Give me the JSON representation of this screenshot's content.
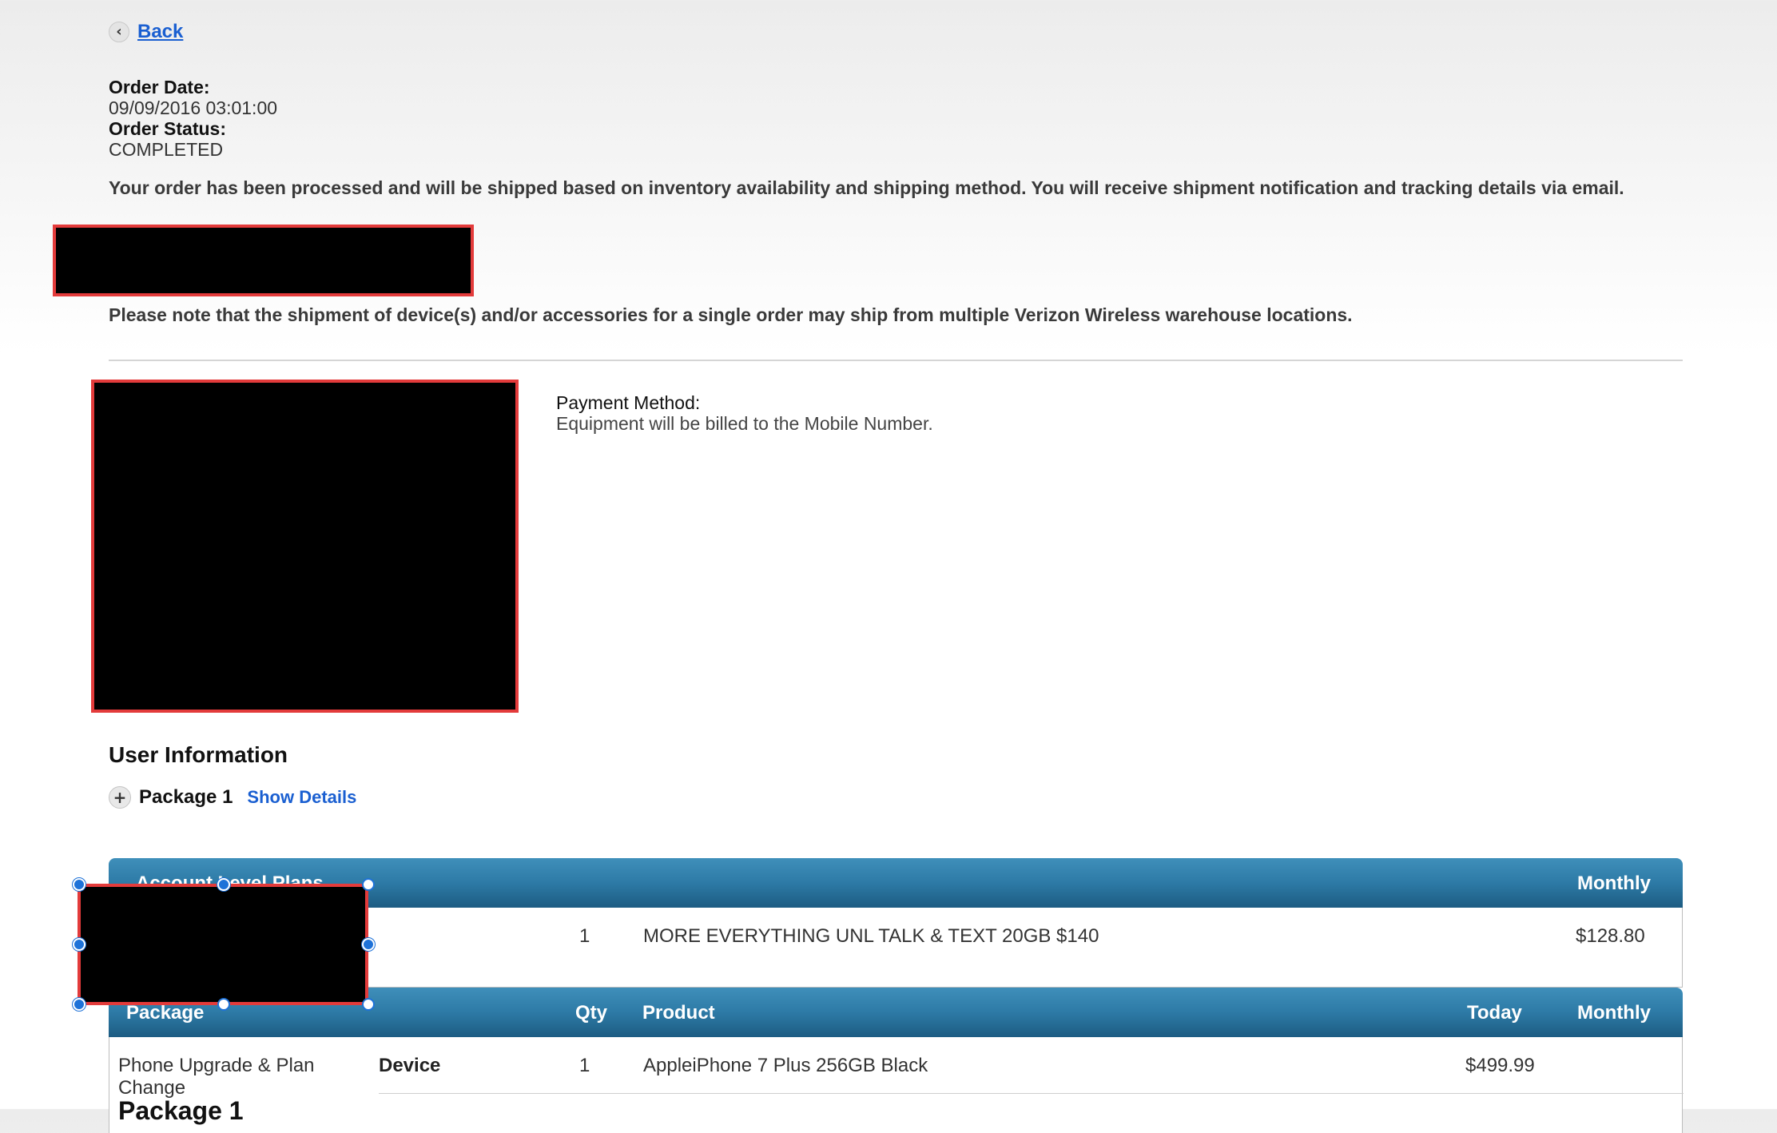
{
  "nav": {
    "back_label": "Back",
    "back_icon": "chevron-left-icon"
  },
  "order": {
    "date_label": "Order Date:",
    "date_value": "09/09/2016 03:01:00",
    "status_label": "Order Status:",
    "status_value": "COMPLETED",
    "processed_message": "Your order has been processed and will be shipped based on inventory availability and shipping method. You will receive shipment notification and tracking details via email.",
    "warehouse_note": "Please note that the shipment of device(s) and/or accessories for a single order may ship from multiple Verizon Wireless warehouse locations."
  },
  "payment": {
    "label": "Payment Method:",
    "value": "Equipment will be billed to the Mobile Number."
  },
  "user_info": {
    "title": "User Information",
    "package_label": "Package 1",
    "show_details": "Show Details",
    "expand_icon": "plus-icon"
  },
  "account_plans": {
    "header": {
      "title": "Account Level Plans",
      "monthly": "Monthly"
    },
    "row": {
      "qty": "1",
      "product": "MORE EVERYTHING UNL TALK & TEXT 20GB $140",
      "monthly": "$128.80"
    }
  },
  "package_table": {
    "header": {
      "package": "Package",
      "qty": "Qty",
      "product": "Product",
      "today": "Today",
      "monthly": "Monthly"
    },
    "row": {
      "package": "Phone Upgrade & Plan Change",
      "type": "Device",
      "qty": "1",
      "product": "AppleiPhone 7 Plus 256GB Black",
      "today": "$499.99"
    },
    "next_package": "Package 1"
  },
  "colors": {
    "link": "#1a5fd1",
    "table_header": "#2d7aa6",
    "redaction_border": "#e33b3b",
    "selection_handle": "#1e72d8"
  }
}
